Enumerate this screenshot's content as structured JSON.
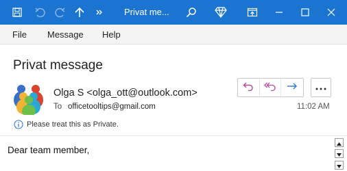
{
  "window": {
    "title": "Privat me...",
    "accent": "#1b75d0"
  },
  "toolbar_icons": [
    "save-icon",
    "undo-icon",
    "redo-icon",
    "up-arrow-icon",
    "more-chevrons-icon",
    "search-icon",
    "diamond-icon",
    "restore-ribbon-icon",
    "minimize-icon",
    "maximize-icon",
    "close-icon"
  ],
  "menu": {
    "items": [
      "File",
      "Message",
      "Help"
    ]
  },
  "message": {
    "subject": "Privat message",
    "sender": "Olga S <olga_ott@outlook.com>",
    "to_label": "To",
    "to_value": "officetooltips@gmail.com",
    "time": "11:02 AM",
    "info": "Please treat this as Private.",
    "body": "Dear team member,"
  },
  "actions": {
    "icons": [
      "reply-icon",
      "reply-all-icon",
      "forward-icon",
      "more-options-icon"
    ],
    "reply_color": "#b4459b",
    "forward_color": "#2b7cd3"
  }
}
